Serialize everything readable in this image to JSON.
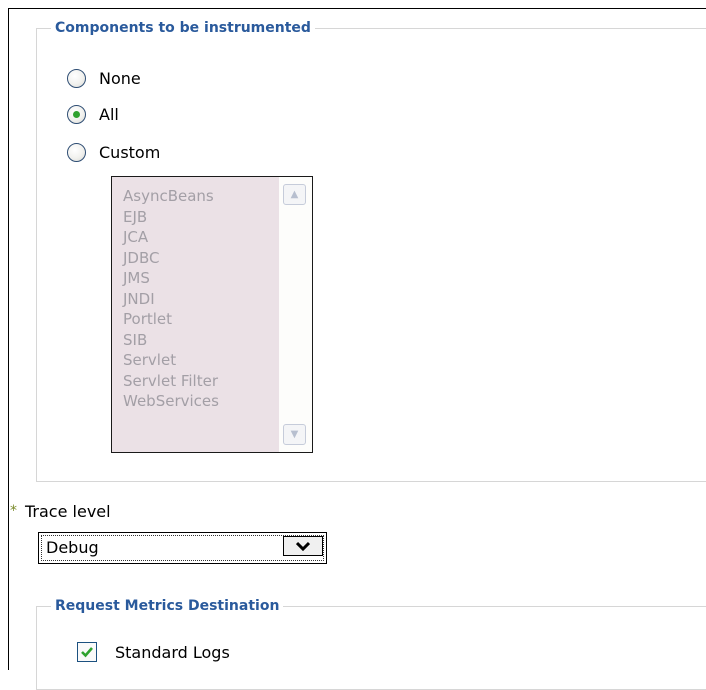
{
  "components": {
    "legend": "Components to be instrumented",
    "options": [
      {
        "label": "None",
        "checked": false
      },
      {
        "label": "All",
        "checked": true
      },
      {
        "label": "Custom",
        "checked": false
      }
    ],
    "custom_list": [
      "AsyncBeans",
      "EJB",
      "JCA",
      "JDBC",
      "JMS",
      "JNDI",
      "Portlet",
      "SIB",
      "Servlet",
      "Servlet Filter",
      "WebServices"
    ]
  },
  "trace_level": {
    "required_marker": "*",
    "label": "Trace level",
    "value": "Debug"
  },
  "destination": {
    "legend": "Request Metrics Destination",
    "standard_logs_label": "Standard Logs",
    "standard_logs_checked": true
  },
  "colors": {
    "legend_text": "#2a5a9c",
    "radio_selected": "#2fa22f",
    "listbox_disabled_bg": "#ebe1e6"
  }
}
